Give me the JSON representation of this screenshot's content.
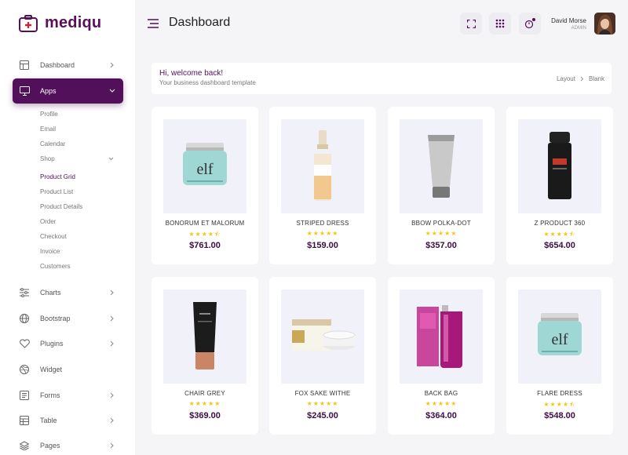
{
  "brand": {
    "name": "mediqu"
  },
  "header": {
    "title": "Dashboard",
    "user": {
      "name": "David Morse",
      "role": "ADMIN"
    }
  },
  "sidebar": {
    "items": [
      {
        "label": "Dashboard",
        "icon": "dashboard-icon"
      },
      {
        "label": "Apps",
        "icon": "monitor-icon"
      },
      {
        "label": "Charts",
        "icon": "sliders-icon"
      },
      {
        "label": "Bootstrap",
        "icon": "globe-icon"
      },
      {
        "label": "Plugins",
        "icon": "heart-icon"
      },
      {
        "label": "Widget",
        "icon": "dribbble-icon"
      },
      {
        "label": "Forms",
        "icon": "form-icon"
      },
      {
        "label": "Table",
        "icon": "table-icon"
      },
      {
        "label": "Pages",
        "icon": "layers-icon"
      }
    ],
    "apps_sub": [
      "Profile",
      "Email",
      "Calendar",
      "Shop"
    ],
    "shop_sub": [
      "Product Grid",
      "Product List",
      "Product Details",
      "Order",
      "Checkout",
      "Invoice",
      "Customers"
    ]
  },
  "welcome": {
    "title": "Hi, welcome back!",
    "subtitle": "Your business dashboard template",
    "breadcrumb": [
      "Layout",
      "Blank"
    ]
  },
  "products": [
    {
      "name": "BONORUM ET MALORUM",
      "price": "$761.00",
      "rating": 4.5,
      "stars": "★★★★⯪",
      "image": "cream-jar-icon"
    },
    {
      "name": "STRIPED DRESS",
      "price": "$159.00",
      "rating": 5,
      "stars": "★★★★★",
      "image": "dropper-bottle-icon"
    },
    {
      "name": "BBOW POLKA-DOT",
      "price": "$357.00",
      "rating": 5,
      "stars": "★★★★★",
      "image": "tube-icon"
    },
    {
      "name": "Z PRODUCT 360",
      "price": "$654.00",
      "rating": 4.5,
      "stars": "★★★★⯪",
      "image": "spray-can-icon"
    },
    {
      "name": "CHAIR GREY",
      "price": "$369.00",
      "rating": 5,
      "stars": "★★★★★",
      "image": "black-tube-icon"
    },
    {
      "name": "FOX SAKE WITHE",
      "price": "$245.00",
      "rating": 5,
      "stars": "★★★★★",
      "image": "aloe-cream-icon"
    },
    {
      "name": "BACK BAG",
      "price": "$364.00",
      "rating": 5,
      "stars": "★★★★★",
      "image": "serum-box-icon"
    },
    {
      "name": "FLARE DRESS",
      "price": "$548.00",
      "rating": 4.5,
      "stars": "★★★★⯪",
      "image": "cream-jar-icon"
    }
  ],
  "colors": {
    "accent": "#52105a",
    "star": "#f5c518",
    "price": "#3d0c43",
    "brand_red": "#e0163a"
  }
}
